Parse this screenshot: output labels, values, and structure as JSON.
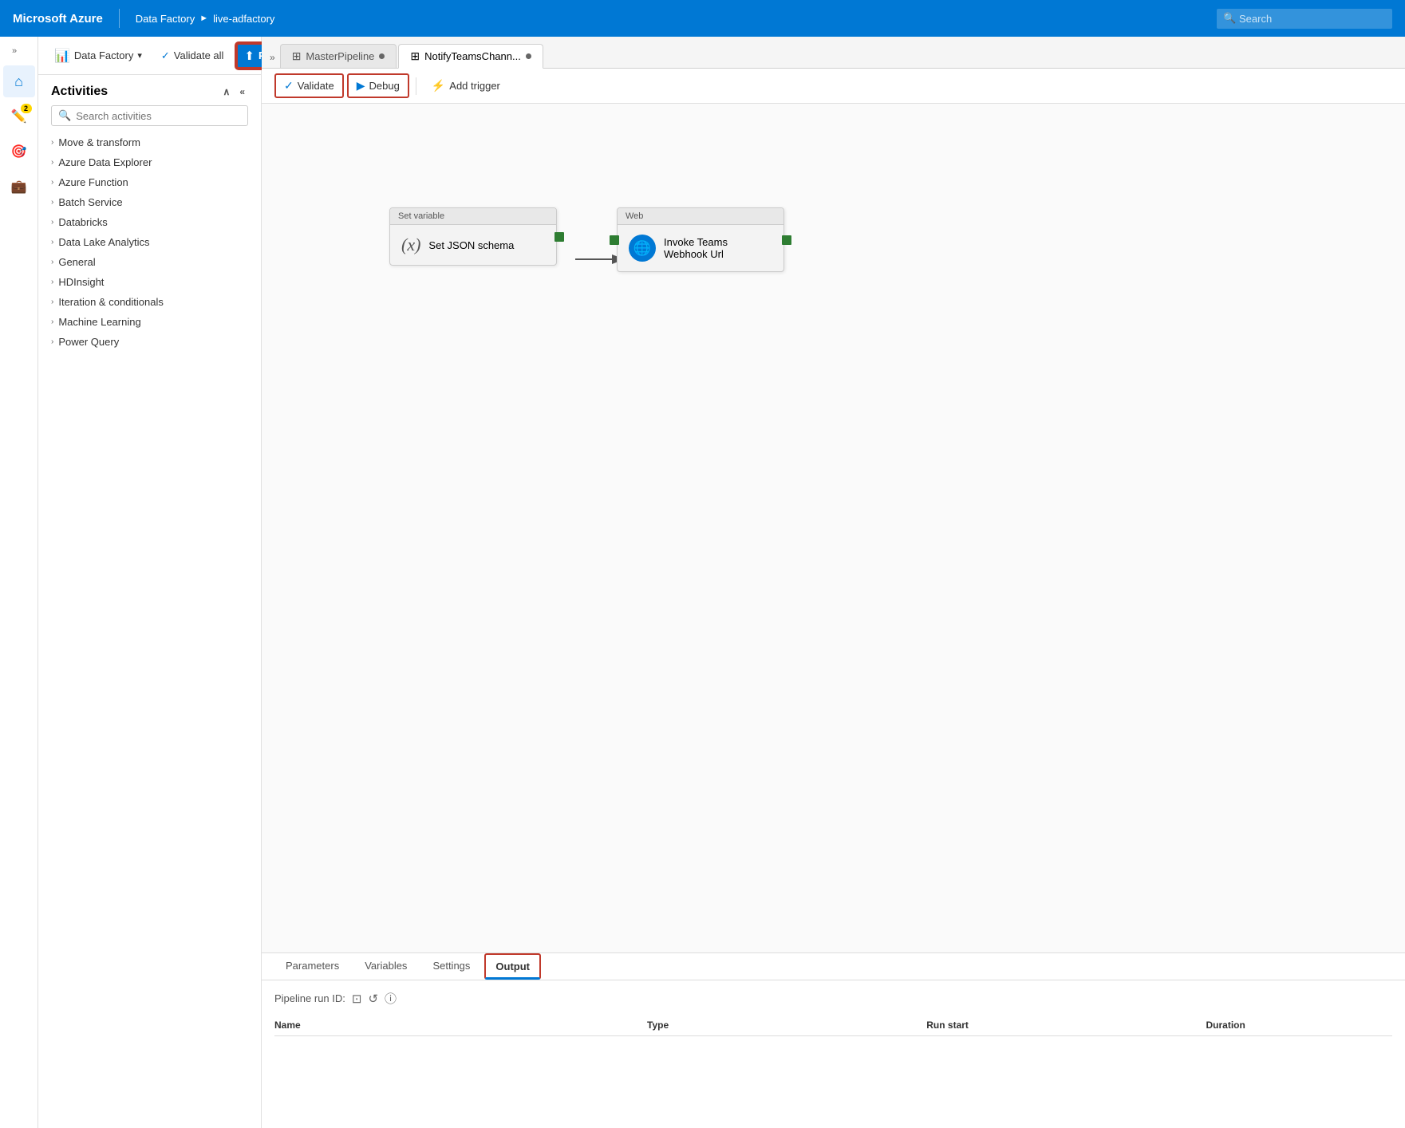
{
  "topbar": {
    "brand": "Microsoft Azure",
    "breadcrumb": [
      "Data Factory",
      "live-adfactory"
    ],
    "search_placeholder": "Search"
  },
  "toolbar": {
    "data_factory_label": "Data Factory",
    "validate_all_label": "Validate all",
    "publish_all_label": "Publish all",
    "publish_badge": "2"
  },
  "tabs": [
    {
      "id": "master",
      "label": "MasterPipeline",
      "active": false
    },
    {
      "id": "notify",
      "label": "NotifyTeamsChann...",
      "active": true
    }
  ],
  "pipeline_toolbar": {
    "validate_label": "Validate",
    "debug_label": "Debug",
    "add_trigger_label": "Add trigger"
  },
  "activities_panel": {
    "title": "Activities",
    "search_placeholder": "Search activities",
    "categories": [
      "Move & transform",
      "Azure Data Explorer",
      "Azure Function",
      "Batch Service",
      "Databricks",
      "Data Lake Analytics",
      "General",
      "HDInsight",
      "Iteration & conditionals",
      "Machine Learning",
      "Power Query"
    ]
  },
  "canvas": {
    "node1": {
      "header": "Set variable",
      "body": "Set JSON schema",
      "icon_type": "set_var"
    },
    "node2": {
      "header": "Web",
      "body": "Invoke Teams\nWebhook Url",
      "icon_type": "web"
    }
  },
  "bottom_panel": {
    "tabs": [
      "Parameters",
      "Variables",
      "Settings",
      "Output"
    ],
    "active_tab": "Output",
    "pipeline_run_label": "Pipeline run ID:",
    "table_headers": [
      "Name",
      "Type",
      "Run start",
      "Duration"
    ]
  },
  "icons": {
    "home": "⌂",
    "pencil": "✏",
    "globe": "⊙",
    "briefcase": "💼",
    "chevron_right": "›",
    "chevron_down": "∨",
    "chevron_left": "‹",
    "expand": "»",
    "collapse": "«",
    "search": "🔍",
    "validate": "✓",
    "debug": "▶",
    "trigger": "⚡",
    "upload": "⬆",
    "copy": "⊡",
    "refresh": "↺",
    "info": "ⓘ"
  }
}
